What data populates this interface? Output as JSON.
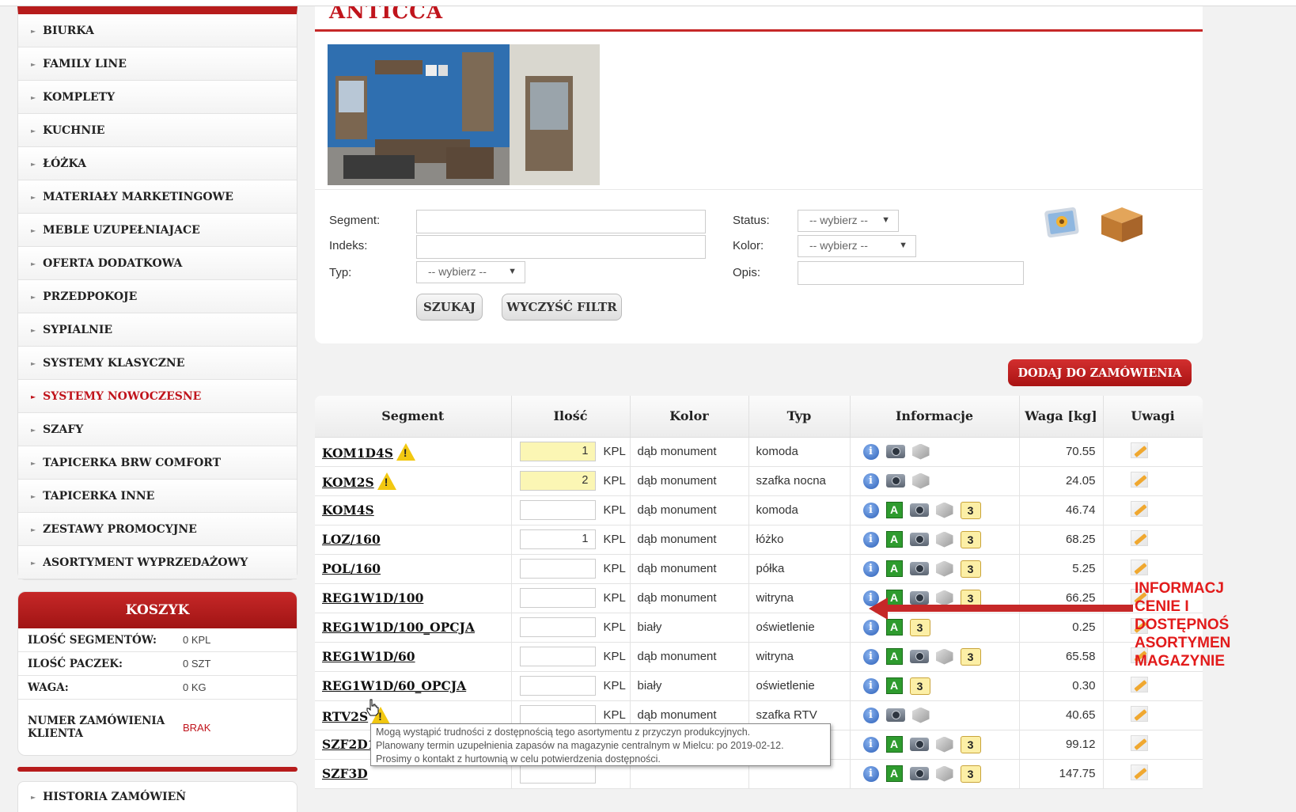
{
  "menu": {
    "items": [
      {
        "label": "BIURKA",
        "active": false
      },
      {
        "label": "FAMILY LINE",
        "active": false
      },
      {
        "label": "KOMPLETY",
        "active": false
      },
      {
        "label": "KUCHNIE",
        "active": false
      },
      {
        "label": "ŁÓŻKA",
        "active": false
      },
      {
        "label": "MATERIAŁY MARKETINGOWE",
        "active": false
      },
      {
        "label": "MEBLE UZUPEŁNIAJACE",
        "active": false
      },
      {
        "label": "OFERTA DODATKOWA",
        "active": false
      },
      {
        "label": "PRZEDPOKOJE",
        "active": false
      },
      {
        "label": "SYPIALNIE",
        "active": false
      },
      {
        "label": "SYSTEMY KLASYCZNE",
        "active": false
      },
      {
        "label": "SYSTEMY NOWOCZESNE",
        "active": true
      },
      {
        "label": "SZAFY",
        "active": false
      },
      {
        "label": "TAPICERKA BRW COMFORT",
        "active": false
      },
      {
        "label": "TAPICERKA INNE",
        "active": false
      },
      {
        "label": "ZESTAWY PROMOCYJNE",
        "active": false
      },
      {
        "label": "ASORTYMENT WYPRZEDAŻOWY",
        "active": false
      }
    ]
  },
  "cart": {
    "title": "KOSZYK",
    "rows": [
      {
        "label": "ILOŚĆ SEGMENTÓW:",
        "value": "0  KPL"
      },
      {
        "label": "ILOŚĆ PACZEK:",
        "value": "0  SZT"
      },
      {
        "label": "WAGA:",
        "value": "0  KG"
      }
    ],
    "order_label": "NUMER ZAMÓWIENIA KLIENTA",
    "order_value": "BRAK"
  },
  "history_label": "HISTORIA ZAMÓWIEŃ",
  "page_title": "ANTICCA",
  "filters": {
    "segment_label": "Segment:",
    "index_label": "Indeks:",
    "type_label": "Typ:",
    "type_value": "-- wybierz --",
    "status_label": "Status:",
    "status_value": "-- wybierz --",
    "color_label": "Kolor:",
    "color_value": "-- wybierz --",
    "desc_label": "Opis:",
    "search_button": "SZUKAJ",
    "clear_button": "WYCZYŚĆ FILTR"
  },
  "add_to_order": "DODAJ DO ZAMÓWIENIA",
  "table": {
    "headers": [
      "Segment",
      "Ilość",
      "Kolor",
      "Typ",
      "Informacje",
      "Waga [kg]",
      "Uwagi"
    ],
    "rows": [
      {
        "segment": "KOM1D4S",
        "warn": true,
        "qty": "1",
        "qty_highlight": true,
        "unit": "KPL",
        "color": "dąb monument",
        "type": "komoda",
        "icons": [
          "info",
          "camera",
          "box"
        ],
        "stock": "",
        "weight": "70.55"
      },
      {
        "segment": "KOM2S",
        "warn": true,
        "qty": "2",
        "qty_highlight": true,
        "unit": "KPL",
        "color": "dąb monument",
        "type": "szafka nocna",
        "icons": [
          "info",
          "camera",
          "box"
        ],
        "stock": "",
        "weight": "24.05"
      },
      {
        "segment": "KOM4S",
        "warn": false,
        "qty": "",
        "qty_highlight": false,
        "unit": "KPL",
        "color": "dąb monument",
        "type": "komoda",
        "icons": [
          "info",
          "a",
          "camera",
          "box"
        ],
        "stock": "3",
        "weight": "46.74"
      },
      {
        "segment": "LOZ/160",
        "warn": false,
        "qty": "1",
        "qty_highlight": false,
        "unit": "KPL",
        "color": "dąb monument",
        "type": "łóżko",
        "icons": [
          "info",
          "a",
          "camera",
          "box"
        ],
        "stock": "3",
        "weight": "68.25"
      },
      {
        "segment": "POL/160",
        "warn": false,
        "qty": "",
        "qty_highlight": false,
        "unit": "KPL",
        "color": "dąb monument",
        "type": "półka",
        "icons": [
          "info",
          "a",
          "camera",
          "box"
        ],
        "stock": "3",
        "weight": "5.25"
      },
      {
        "segment": "REG1W1D/100",
        "warn": false,
        "qty": "",
        "qty_highlight": false,
        "unit": "KPL",
        "color": "dąb monument",
        "type": "witryna",
        "icons": [
          "info",
          "a",
          "camera",
          "box"
        ],
        "stock": "3",
        "weight": "66.25"
      },
      {
        "segment": "REG1W1D/100_OPCJA",
        "warn": false,
        "qty": "",
        "qty_highlight": false,
        "unit": "KPL",
        "color": "biały",
        "type": "oświetlenie",
        "icons": [
          "info",
          "a"
        ],
        "stock": "3",
        "weight": "0.25"
      },
      {
        "segment": "REG1W1D/60",
        "warn": false,
        "qty": "",
        "qty_highlight": false,
        "unit": "KPL",
        "color": "dąb monument",
        "type": "witryna",
        "icons": [
          "info",
          "a",
          "camera",
          "box"
        ],
        "stock": "3",
        "weight": "65.58"
      },
      {
        "segment": "REG1W1D/60_OPCJA",
        "warn": false,
        "qty": "",
        "qty_highlight": false,
        "unit": "KPL",
        "color": "biały",
        "type": "oświetlenie",
        "icons": [
          "info",
          "a"
        ],
        "stock": "3",
        "weight": "0.30"
      },
      {
        "segment": "RTV2S",
        "warn": true,
        "qty": "",
        "qty_highlight": false,
        "unit": "KPL",
        "color": "dąb monument",
        "type": "szafka RTV",
        "icons": [
          "info",
          "camera",
          "box"
        ],
        "stock": "",
        "weight": "40.65"
      },
      {
        "segment": "SZF2D1S",
        "warn": false,
        "qty": "",
        "qty_highlight": false,
        "unit": "",
        "color": "",
        "type": "",
        "icons": [
          "info",
          "a",
          "camera",
          "box"
        ],
        "stock": "3",
        "weight": "99.12"
      },
      {
        "segment": "SZF3D",
        "warn": false,
        "qty": "",
        "qty_highlight": false,
        "unit": "",
        "color": "",
        "type": "",
        "icons": [
          "info",
          "a",
          "camera",
          "box"
        ],
        "stock": "3",
        "weight": "147.75"
      }
    ]
  },
  "tooltip": {
    "line1": "Mogą wystąpić trudności z dostępnością tego asortymentu z przyczyn produkcyjnych.",
    "line2": "Planowany termin uzupełnienia zapasów na magazynie centralnym w Mielcu: po 2019-02-12.",
    "line3": "Prosimy o kontakt z hurtownią w celu potwierdzenia dostępności."
  },
  "annotation": {
    "lines": [
      "INFORMACJ",
      "CENIE I",
      "DOSTĘPNOŚ",
      "ASORTYMEN",
      "MAGAZYNIE"
    ]
  },
  "colors": {
    "brand_red": "#c62828",
    "active_menu": "#c0141c",
    "annotation_red": "#e21b1b"
  }
}
